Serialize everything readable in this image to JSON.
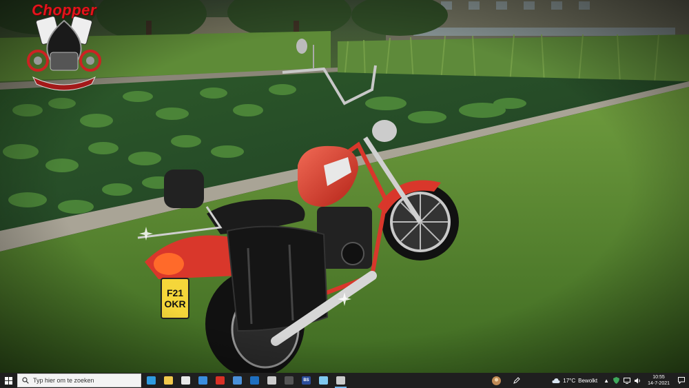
{
  "logo": {
    "title": "Chopper"
  },
  "plate": {
    "line1": "F21",
    "line2": "OKR"
  },
  "taskbar": {
    "search_placeholder": "Typ hier om te zoeken",
    "apps": [
      {
        "name": "edge-browser-icon",
        "color": "#2f9be0"
      },
      {
        "name": "file-explorer-icon",
        "color": "#f2c94c"
      },
      {
        "name": "store-icon",
        "color": "#e8e8e8"
      },
      {
        "name": "mail-icon",
        "color": "#3a8dde"
      },
      {
        "name": "gmail-icon",
        "color": "#d93025"
      },
      {
        "name": "people-icon",
        "color": "#4a90d9"
      },
      {
        "name": "outlook-icon",
        "color": "#1e6fc0"
      },
      {
        "name": "video-icon",
        "color": "#cccccc"
      },
      {
        "name": "calculator-icon",
        "color": "#555555"
      },
      {
        "name": "bs-app-icon",
        "color": "#2b4d9b",
        "label": "BS"
      },
      {
        "name": "photos-icon",
        "color": "#7fc8ef"
      },
      {
        "name": "chopper-app-icon",
        "color": "#cccccc"
      }
    ],
    "weather": {
      "temp": "17°C",
      "desc": "Bewolkt"
    },
    "clock": {
      "time": "10:55",
      "date": "14-7-2021"
    }
  },
  "colors": {
    "bike_red": "#d9372b",
    "grass": "#5f8f35",
    "taskbar_bg": "#1f1f1f",
    "accent": "#76b9ed"
  }
}
